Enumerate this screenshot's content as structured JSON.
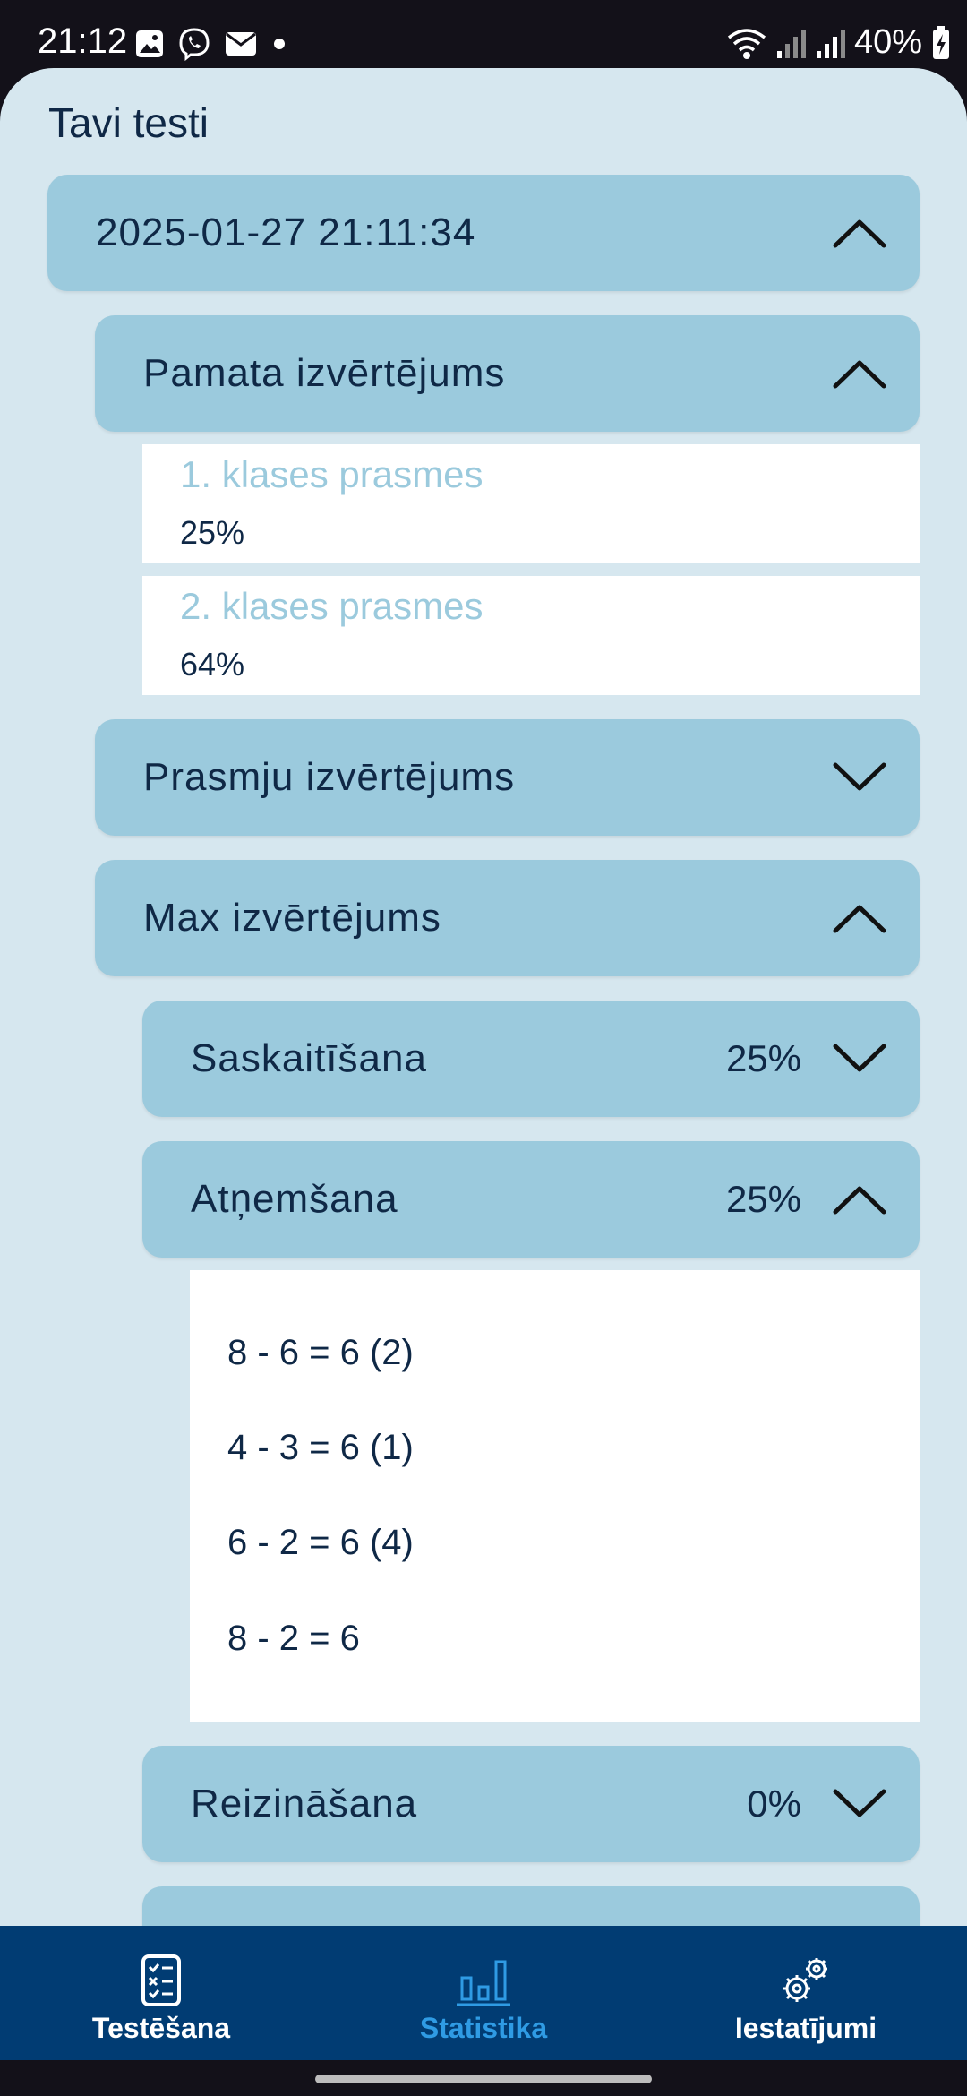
{
  "status_bar": {
    "time": "21:12",
    "battery": "40%",
    "icons": [
      "gallery-icon",
      "viber-icon",
      "mail-icon",
      "dot-icon",
      "wifi-icon",
      "signal-icon",
      "signal-icon",
      "battery-charging-icon"
    ]
  },
  "page": {
    "title": "Tavi testi"
  },
  "test": {
    "datetime": "2025-01-27 21:11:34",
    "expanded": true,
    "sections": {
      "basic": {
        "label": "Pamata izvērtējums",
        "expanded": true,
        "skills": [
          {
            "name": "1. klases prasmes",
            "value": "25%"
          },
          {
            "name": "2. klases prasmes",
            "value": "64%"
          }
        ]
      },
      "skills": {
        "label": "Prasmju izvērtējums",
        "expanded": false
      },
      "max": {
        "label": "Max izvērtējums",
        "expanded": true,
        "categories": [
          {
            "label": "Saskaitīšana",
            "percent": "25%",
            "expanded": false
          },
          {
            "label": "Atņemšana",
            "percent": "25%",
            "expanded": true,
            "equations": [
              "8 - 6 = 6 (2)",
              "4 - 3 = 6 (1)",
              "6 - 2 = 6 (4)",
              "8 - 2 = 6"
            ]
          },
          {
            "label": "Reizināšana",
            "percent": "0%",
            "expanded": false
          },
          {
            "label": "",
            "percent": "",
            "expanded": false
          }
        ]
      }
    }
  },
  "nav": {
    "items": [
      {
        "label": "Testēšana",
        "icon": "checklist-icon",
        "active": false
      },
      {
        "label": "Statistika",
        "icon": "bar-chart-icon",
        "active": true
      },
      {
        "label": "Iestatījumi",
        "icon": "gears-icon",
        "active": false
      }
    ]
  },
  "colors": {
    "background": "#d6e7ef",
    "card": "#9bcadd",
    "text": "#0f2846",
    "nav_bg": "#013c73",
    "nav_active": "#2f9be4"
  }
}
